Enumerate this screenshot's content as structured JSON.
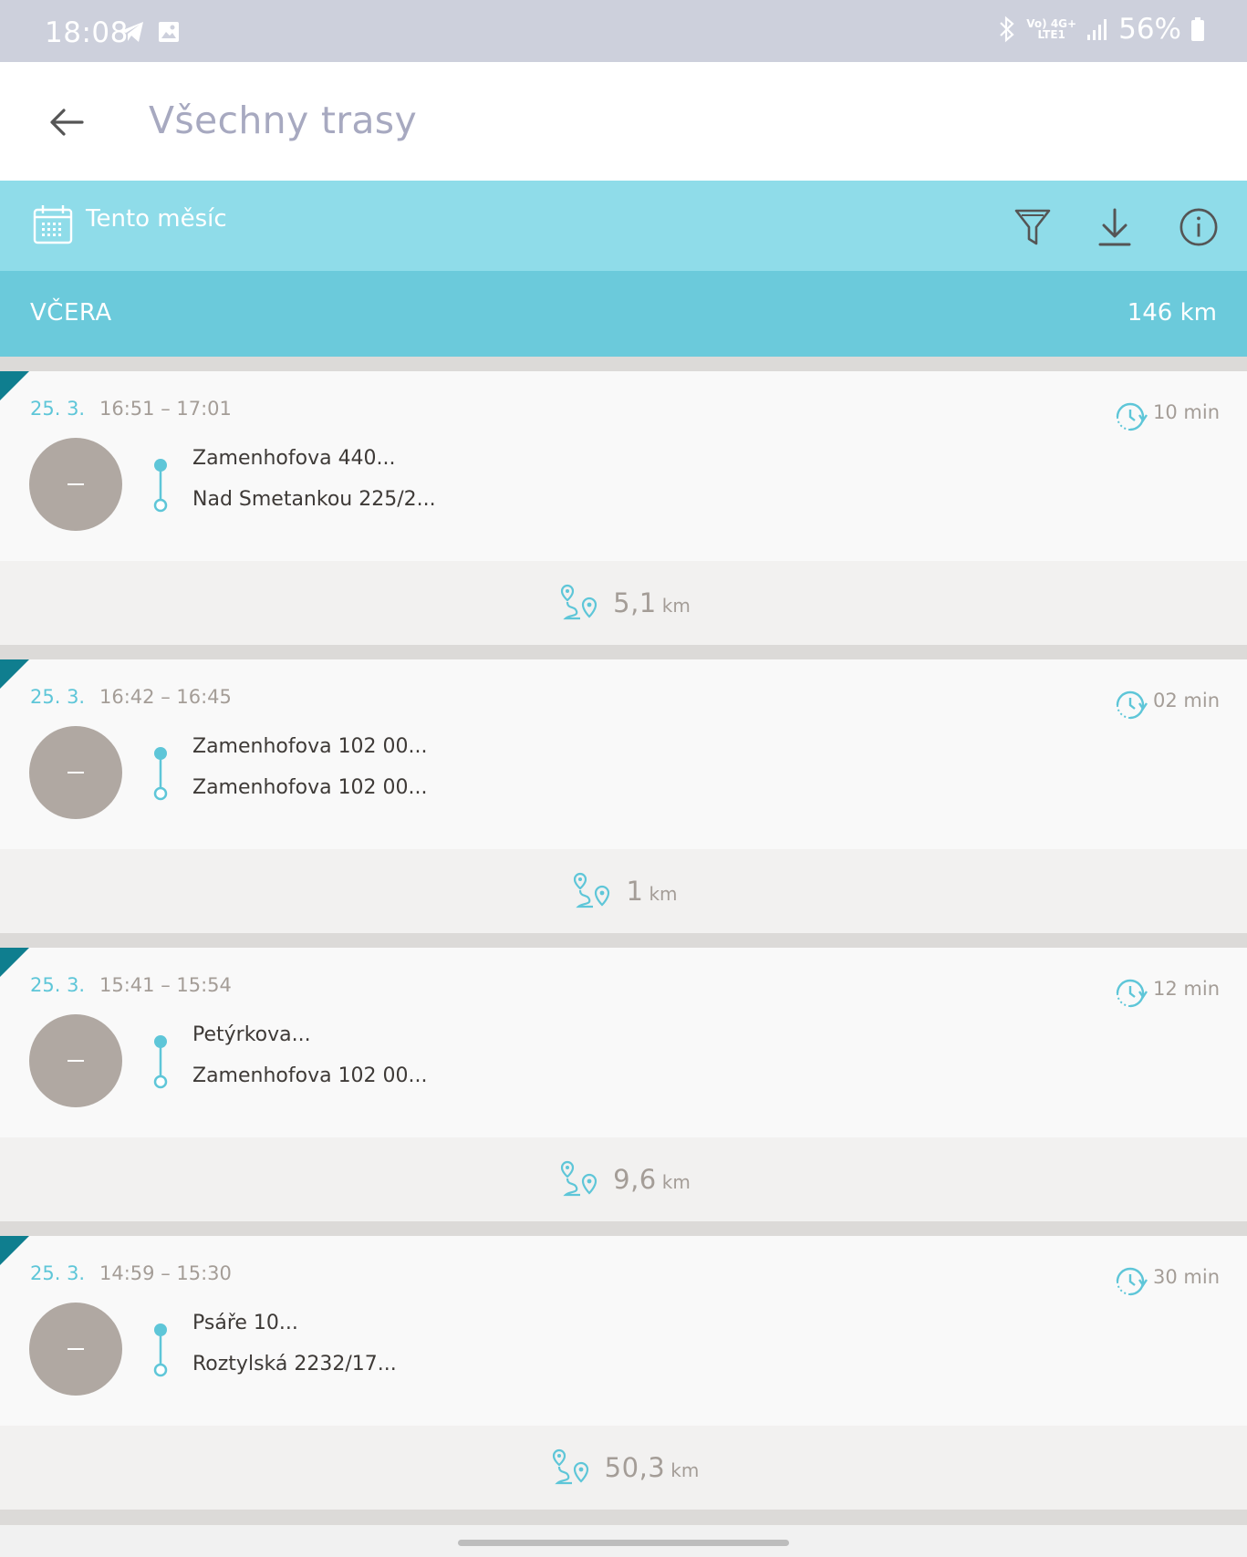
{
  "status_bar": {
    "time": "18:08",
    "battery": "56%",
    "network_top": "Vo) 4G+",
    "network_bottom": "LTE1",
    "icons": [
      "telegram-icon",
      "image-icon",
      "bluetooth-icon",
      "signal-icon",
      "battery-icon"
    ]
  },
  "app_bar": {
    "title": "Všechny trasy",
    "back_icon": "arrow-left-icon"
  },
  "filter_bar": {
    "period": "Tento měsíc",
    "icons": [
      "calendar-icon",
      "filter-icon",
      "download-icon",
      "info-icon"
    ]
  },
  "day_section": {
    "label": "VČERA",
    "total": "146 km"
  },
  "trips": [
    {
      "date": "25. 3.",
      "times": "16:51 – 17:01",
      "duration": "10 min",
      "from": "Zamenhofova 440...",
      "to": "Nad Smetankou 225/2...",
      "distance": "5,1",
      "unit": "km"
    },
    {
      "date": "25. 3.",
      "times": "16:42 – 16:45",
      "duration": "02 min",
      "from": "Zamenhofova 102 00...",
      "to": "Zamenhofova 102 00...",
      "distance": "1",
      "unit": "km"
    },
    {
      "date": "25. 3.",
      "times": "15:41 – 15:54",
      "duration": "12 min",
      "from": "Petýrkova...",
      "to": "Zamenhofova 102 00...",
      "distance": "9,6",
      "unit": "km"
    },
    {
      "date": "25. 3.",
      "times": "14:59 – 15:30",
      "duration": "30 min",
      "from": "Psáře 10...",
      "to": "Roztylská 2232/17...",
      "distance": "50,3",
      "unit": "km"
    }
  ],
  "colors": {
    "accent": "#6bcadb",
    "filter_bar": "#8fdce9",
    "corner_marker": "#0f7e8f",
    "avatar": "#b0a8a2"
  }
}
